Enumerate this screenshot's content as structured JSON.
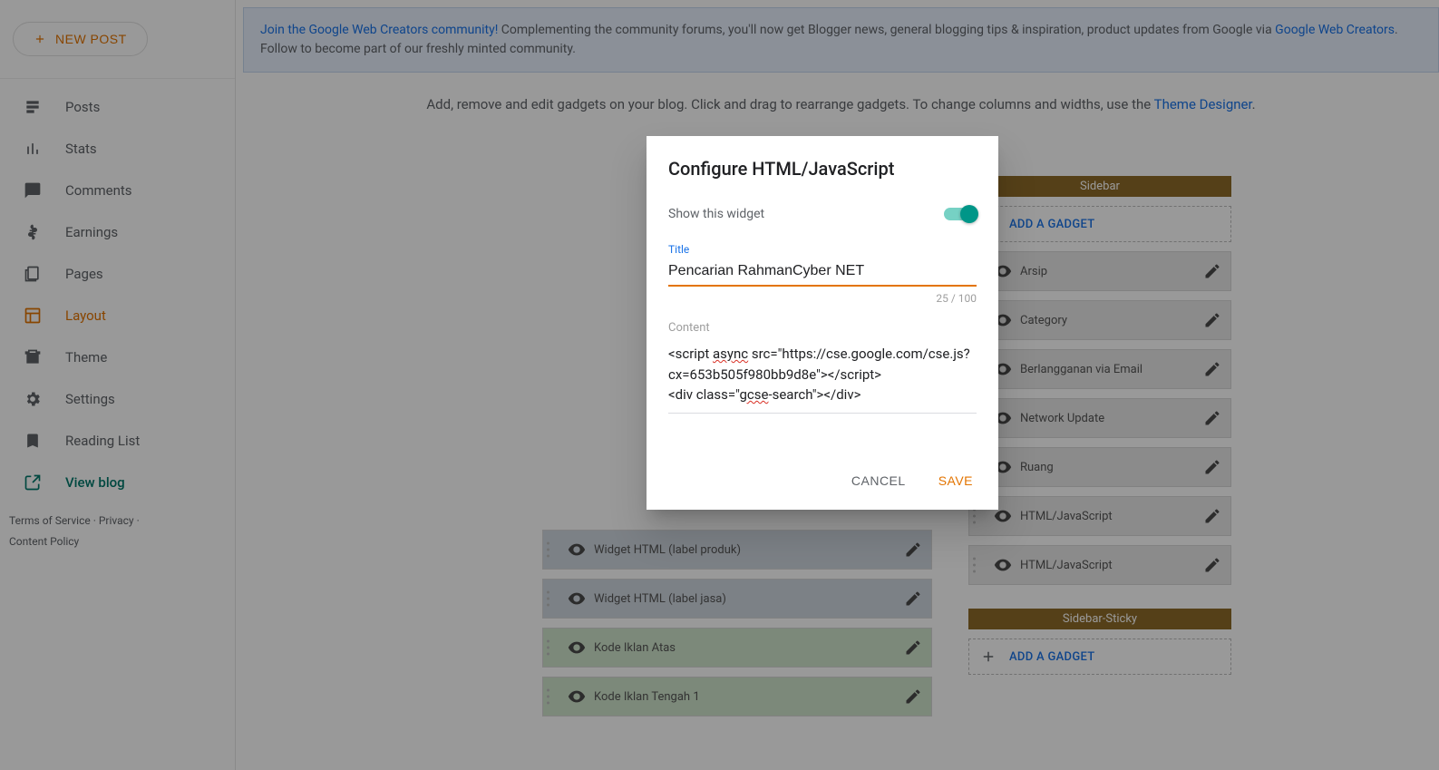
{
  "sidebar": {
    "new_post": "NEW POST",
    "items": [
      {
        "label": "Posts",
        "icon": "posts-icon"
      },
      {
        "label": "Stats",
        "icon": "stats-icon"
      },
      {
        "label": "Comments",
        "icon": "comments-icon"
      },
      {
        "label": "Earnings",
        "icon": "earnings-icon"
      },
      {
        "label": "Pages",
        "icon": "pages-icon"
      },
      {
        "label": "Layout",
        "icon": "layout-icon",
        "active": true
      },
      {
        "label": "Theme",
        "icon": "theme-icon"
      },
      {
        "label": "Settings",
        "icon": "settings-icon"
      },
      {
        "label": "Reading List",
        "icon": "reading-list-icon"
      },
      {
        "label": "View blog",
        "icon": "view-blog-icon",
        "variant": "view-blog"
      }
    ],
    "footer": {
      "terms": "Terms of Service",
      "privacy": "Privacy",
      "content_policy": "Content Policy"
    }
  },
  "notice": {
    "link1": "Join the Google Web Creators community!",
    "text1": " Complementing the community forums, you'll now get Blogger news, general blogging tips & inspiration, product updates from Google via ",
    "link2": "Google Web Creators",
    "text2": ". Follow to become part of our freshly minted community."
  },
  "hint": {
    "text1": "Add, remove and edit gadgets on your blog. Click and drag to rearrange gadgets. To change columns and widths, use the ",
    "link": "Theme Designer",
    "text2": "."
  },
  "layout": {
    "left_gadgets": [
      {
        "name": "Widget HTML (label produk)",
        "cls": "blue",
        "eye": "visible"
      },
      {
        "name": "Widget HTML (label jasa)",
        "cls": "blue",
        "eye": "visible"
      },
      {
        "name": "Kode Iklan Atas",
        "cls": "green",
        "eye": "visible"
      },
      {
        "name": "Kode Iklan Tengah 1",
        "cls": "green",
        "eye": "visible"
      }
    ],
    "right_header": "Sidebar",
    "add_gadget": "ADD A GADGET",
    "right_gadgets": [
      {
        "name": "Arsip"
      },
      {
        "name": "Category"
      },
      {
        "name": "Berlangganan via Email"
      },
      {
        "name": "Network Update"
      },
      {
        "name": "Ruang"
      },
      {
        "name": "HTML/JavaScript"
      },
      {
        "name": "HTML/JavaScript"
      }
    ],
    "sticky_header": "Sidebar-Sticky"
  },
  "dialog": {
    "title": "Configure HTML/JavaScript",
    "show_widget": "Show this widget",
    "title_label": "Title",
    "title_value": "Pencarian RahmanCyber NET",
    "char_count": "25 / 100",
    "content_label": "Content",
    "content_value": "<script async src=\"https://cse.google.com/cse.js?cx=653b505f980bb9d8e\"></script>\n<div class=\"gcse-search\"></div>",
    "cancel": "CANCEL",
    "save": "SAVE"
  }
}
